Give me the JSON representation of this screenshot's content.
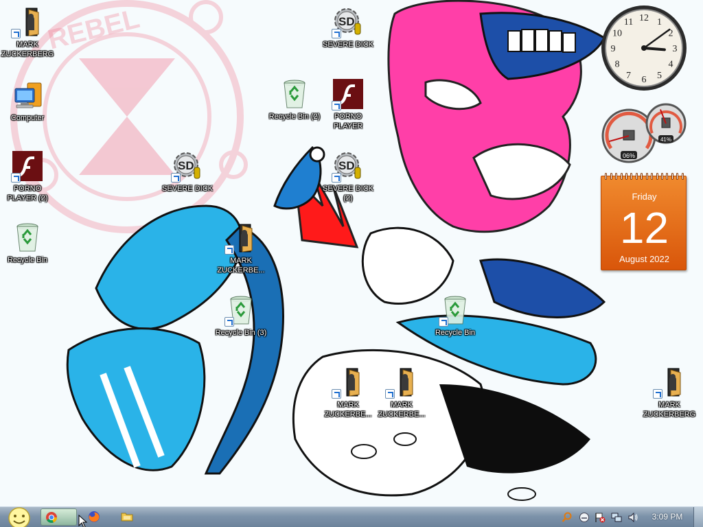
{
  "desktop": {
    "icons": [
      {
        "id": "mark-zuckerberg-1",
        "label": "MARK ZUCKERBERG",
        "type": "shortcut-file"
      },
      {
        "id": "computer",
        "label": "Computer",
        "type": "computer"
      },
      {
        "id": "porno-player-2",
        "label": "PORNO PLAYER (2)",
        "type": "flash"
      },
      {
        "id": "recycle-bin-1",
        "label": "Recycle Bin",
        "type": "recycle-bin"
      },
      {
        "id": "severe-dick-1",
        "label": "SEVERE DICK",
        "type": "sd-gear"
      },
      {
        "id": "mark-zuckerberg-2",
        "label": "MARK ZUCKERBE...",
        "type": "shortcut-file"
      },
      {
        "id": "recycle-bin-3",
        "label": "Recycle Bin (3)",
        "type": "recycle-bin"
      },
      {
        "id": "recycle-bin-2",
        "label": "Recycle Bin (2)",
        "type": "recycle-bin"
      },
      {
        "id": "severe-dick-top",
        "label": "SEVERE DICK",
        "type": "sd-gear"
      },
      {
        "id": "porno-player",
        "label": "PORNO PLAYER",
        "type": "flash"
      },
      {
        "id": "severe-dick-2",
        "label": "SEVERE DICK (2)",
        "type": "sd-gear"
      },
      {
        "id": "mark-zuckerberg-3",
        "label": "MARK ZUCKERBE...",
        "type": "shortcut-file"
      },
      {
        "id": "mark-zuckerberg-4",
        "label": "MARK ZUCKERBE...",
        "type": "shortcut-file"
      },
      {
        "id": "recycle-bin-4",
        "label": "Recycle Bin",
        "type": "recycle-bin"
      },
      {
        "id": "mark-zuckerberg-5",
        "label": "MARK ZUCKERBERG",
        "type": "shortcut-file"
      }
    ],
    "wallpaper_watermark": "REBEL"
  },
  "gadgets": {
    "clock": {
      "numerals": [
        "12",
        "1",
        "2",
        "3",
        "4",
        "5",
        "6",
        "7",
        "8",
        "9",
        "10",
        "11"
      ],
      "hour": 3,
      "minute": 9
    },
    "meter": {
      "cpu_percent": "06%",
      "memory_percent": "41%",
      "cpu_value": 6,
      "memory_value": 41
    },
    "calendar": {
      "day": "Friday",
      "date": "12",
      "month_year": "August 2022"
    }
  },
  "taskbar": {
    "start_icon": "smiley-orb-icon",
    "pinned": [
      {
        "id": "chrome",
        "icon": "chrome-icon",
        "active": true
      },
      {
        "id": "firefox",
        "icon": "firefox-icon",
        "active": false
      },
      {
        "id": "explorer",
        "icon": "folder-icon",
        "active": false
      }
    ],
    "tray_icons": [
      "search-tray-icon",
      "emoji-tray-icon",
      "flag-tray-icon",
      "network-tray-icon",
      "volume-tray-icon"
    ],
    "clock": "3:09 PM"
  },
  "colors": {
    "taskbar": "#7d93aa",
    "calendar": "#e8741c",
    "wallpaper_pink": "#ff3fa8",
    "wallpaper_blue": "#2ab3e8"
  }
}
